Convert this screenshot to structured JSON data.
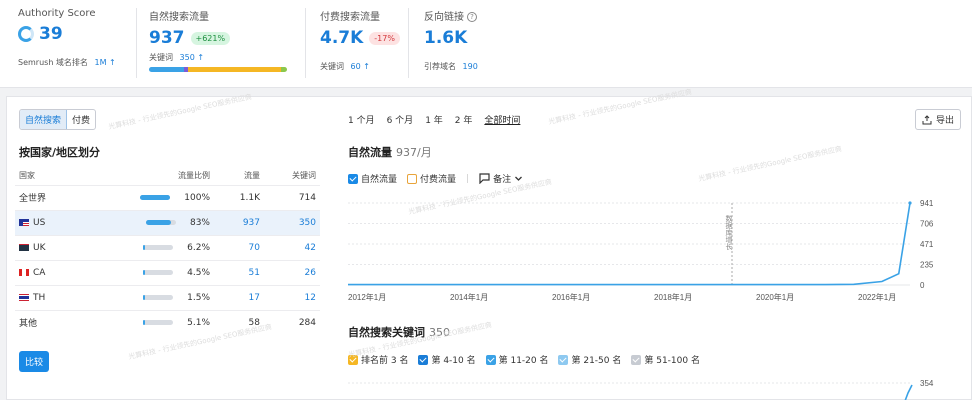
{
  "authority": {
    "label": "Authority Score",
    "value": "39",
    "rank_label": "Semrush 域名排名",
    "rank_value": "1M ↑"
  },
  "organic": {
    "label": "自然搜索流量",
    "value": "937",
    "badge": "+621%",
    "kw_label": "关键词",
    "kw_value": "350 ↑"
  },
  "paid": {
    "label": "付费搜索流量",
    "value": "4.7K",
    "badge": "-17%",
    "kw_label": "关键词",
    "kw_value": "60 ↑"
  },
  "backlinks": {
    "label": "反向链接",
    "value": "1.6K",
    "ref_label": "引荐域名",
    "ref_value": "190"
  },
  "toggle": {
    "organic": "自然搜索",
    "paid": "付费"
  },
  "country": {
    "title": "按国家/地区划分",
    "headers": [
      "国家",
      "流量比例",
      "流量",
      "关键词"
    ],
    "rows": [
      {
        "name": "全世界",
        "share": "100%",
        "share_value": 1.0,
        "traffic": "1.1K",
        "keywords": "714",
        "flag": ""
      },
      {
        "name": "US",
        "share": "83%",
        "share_value": 0.83,
        "traffic": "937",
        "keywords": "350",
        "flag": "us"
      },
      {
        "name": "UK",
        "share": "6.2%",
        "share_value": 0.062,
        "traffic": "70",
        "keywords": "42",
        "flag": "uk"
      },
      {
        "name": "CA",
        "share": "4.5%",
        "share_value": 0.045,
        "traffic": "51",
        "keywords": "26",
        "flag": "ca"
      },
      {
        "name": "TH",
        "share": "1.5%",
        "share_value": 0.015,
        "traffic": "17",
        "keywords": "12",
        "flag": "th"
      },
      {
        "name": "其他",
        "share": "5.1%",
        "share_value": 0.051,
        "traffic": "58",
        "keywords": "284",
        "flag": ""
      }
    ],
    "compare": "比较"
  },
  "periods": [
    "1 个月",
    "6 个月",
    "1 年",
    "2 年",
    "全部时间"
  ],
  "export": "导出",
  "traffic_chart": {
    "title": "自然流量",
    "subtitle": "937/月",
    "legend": {
      "organic": "自然流量",
      "paid": "付费流量",
      "notes": "备注"
    },
    "annotation": "数据库增长"
  },
  "kw_chart": {
    "title": "自然搜索关键词",
    "subtitle": "350",
    "legend": [
      "排名前 3 名",
      "第 4-10 名",
      "第 11-20 名",
      "第 21-50 名",
      "第 51-100 名"
    ],
    "legend_colors": [
      "#f5b724",
      "#1a7dd7",
      "#3aa2e6",
      "#8ec9f0",
      "#c7cbd2"
    ],
    "ymax_label": "354"
  },
  "watermark": "光算科技 - 行业领先的Google SEO服务供应商",
  "chart_data": {
    "type": "line",
    "title": "自然流量",
    "x": [
      "2012年1月",
      "2014年1月",
      "2016年1月",
      "2018年1月",
      "2020年1月",
      "2022年1月"
    ],
    "ylim": [
      0,
      941
    ],
    "yticks": [
      941,
      706,
      471,
      235,
      0
    ],
    "series": [
      {
        "name": "自然流量",
        "points": [
          [
            0,
            5
          ],
          [
            0.85,
            5
          ],
          [
            0.9,
            8
          ],
          [
            0.95,
            40
          ],
          [
            0.98,
            130
          ],
          [
            1.0,
            941
          ]
        ]
      }
    ],
    "grid": true
  }
}
